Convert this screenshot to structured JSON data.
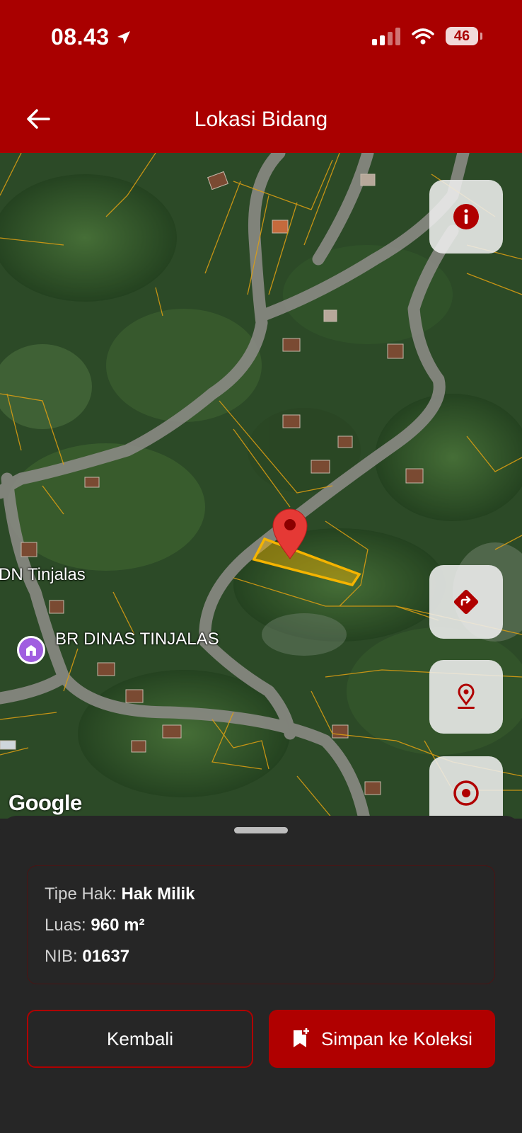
{
  "status_bar": {
    "time": "08.43",
    "battery": "46"
  },
  "header": {
    "title": "Lokasi Bidang"
  },
  "map": {
    "labels": {
      "place_1": "DN Tinjalas",
      "poi": "BR DINAS TINJALAS"
    },
    "attribution": "Google",
    "parcel_color": "#f5b400",
    "marker_color": "#e53935"
  },
  "map_controls": [
    "info-icon",
    "directions-icon",
    "location-pin-icon",
    "my-location-icon"
  ],
  "sheet": {
    "info": {
      "rights_type": {
        "label": "Tipe Hak:",
        "value": "Hak Milik"
      },
      "area": {
        "label": "Luas:",
        "value": "960 m²"
      },
      "nib": {
        "label": "NIB:",
        "value": "01637"
      }
    },
    "buttons": {
      "back": "Kembali",
      "save": "Simpan ke Koleksi"
    }
  },
  "colors": {
    "primary": "#a90000",
    "sheet_bg": "#262626"
  }
}
